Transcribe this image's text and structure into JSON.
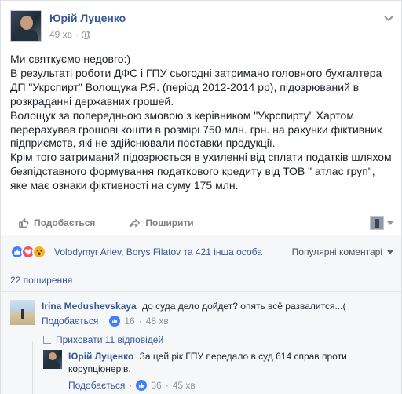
{
  "post": {
    "author": "Юрій Луценко",
    "time": "49 хв",
    "text_lines": [
      "Ми святкуємо недовго:)",
      "В результаті роботи ДФС і ГПУ сьогодні затримано головного бухгалтера ДП \"Укрспирт\" Волощука Р.Я. (період 2012-2014 рр), підозрюваний в розкраданні державних грошей.",
      "Волощук за попередньою змовою з керівником \"Укрспирту\" Хартом перерахував грошові кошти в розмірі 750 млн. грн. на рахунки фіктивних підприємств, які не здійснювали поставки продукції.",
      "Крім того затриманий підозрюється в ухиленні від сплати податків шляхом безпідставного формування податкового кредиту від ТОВ \" атлас груп\", яке має ознаки фіктивності на суму 175 млн."
    ]
  },
  "actions": {
    "like_label": "Подобається",
    "share_label": "Поширити"
  },
  "reactions": {
    "names": "Volodymyr Ariev, Borys Filatov та 421 інша особа",
    "sort_label": "Популярні коментарі",
    "icons": [
      "like-icon",
      "love-icon",
      "wow-icon"
    ],
    "colors": {
      "like": "#4080ff",
      "love": "#f25268",
      "wow": "#f7b125"
    }
  },
  "shares": {
    "label": "22 поширення"
  },
  "comments": [
    {
      "author": "Irina Medushevskaya",
      "text": "до суда дело дойдет? опять всё развалится...(",
      "like_label": "Подобається",
      "likes": "16",
      "time": "48 хв"
    },
    {
      "author": "Юрій Луценко",
      "text_line1": "За цей рік ГПУ передало в суд 614 справ проти",
      "text_line2": "корупціонерів.",
      "like_label": "Подобається",
      "likes": "36",
      "time": "45 хв"
    }
  ],
  "hide_replies": {
    "label": "Приховати 11 відповідей"
  },
  "colors": {
    "link": "#365899",
    "muted": "#90949c",
    "panel": "#f6f7f9"
  }
}
